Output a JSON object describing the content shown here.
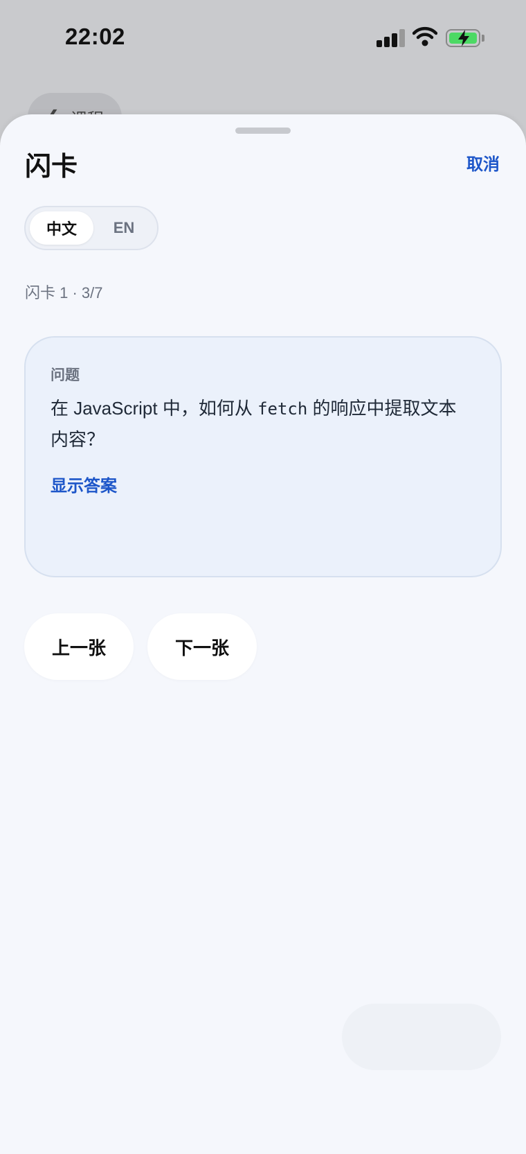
{
  "status_bar": {
    "time": "22:02"
  },
  "background": {
    "back_label": "课程"
  },
  "sheet": {
    "title": "闪卡",
    "cancel_label": "取消",
    "language_toggle": {
      "options": [
        "中文",
        "EN"
      ],
      "selected": "中文"
    },
    "counter": "闪卡 1 · 3/7",
    "card": {
      "label": "问题",
      "question_before": "在 JavaScript 中，如何从 ",
      "question_code": "fetch",
      "question_after": " 的响应中提取文本内容？",
      "show_answer_label": "显示答案"
    },
    "prev_label": "上一张",
    "next_label": "下一张"
  },
  "colors": {
    "accent": "#1d56c9",
    "sheet_bg": "#f5f7fc",
    "card_bg": "#ebf1fb",
    "battery": "#4cd964"
  }
}
